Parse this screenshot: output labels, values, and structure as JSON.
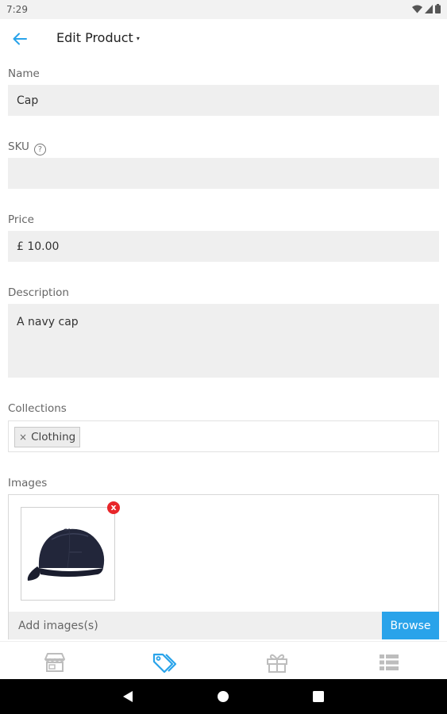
{
  "status_bar": {
    "time": "7:29"
  },
  "app_bar": {
    "title": "Edit Product",
    "caret": "▾"
  },
  "form": {
    "name": {
      "label": "Name",
      "value": "Cap"
    },
    "sku": {
      "label": "SKU",
      "value": ""
    },
    "price": {
      "label": "Price",
      "value": "£ 10.00"
    },
    "description": {
      "label": "Description",
      "value": "A navy cap"
    },
    "collections": {
      "label": "Collections",
      "tags": [
        {
          "remove": "×",
          "label": "Clothing"
        }
      ]
    },
    "images": {
      "label": "Images",
      "remove_symbol": "x",
      "add_placeholder": "Add images(s)",
      "browse_label": "Browse"
    }
  },
  "bottom_nav": {
    "items": [
      {
        "icon": "store-icon",
        "active": false
      },
      {
        "icon": "tags-icon",
        "active": true
      },
      {
        "icon": "gift-icon",
        "active": false
      },
      {
        "icon": "list-icon",
        "active": false
      }
    ],
    "active_color": "#29a3ea",
    "inactive_color": "#bdbdbd"
  },
  "colors": {
    "accent": "#29a3ea",
    "remove": "#e8262a",
    "input_bg": "#efefef"
  }
}
